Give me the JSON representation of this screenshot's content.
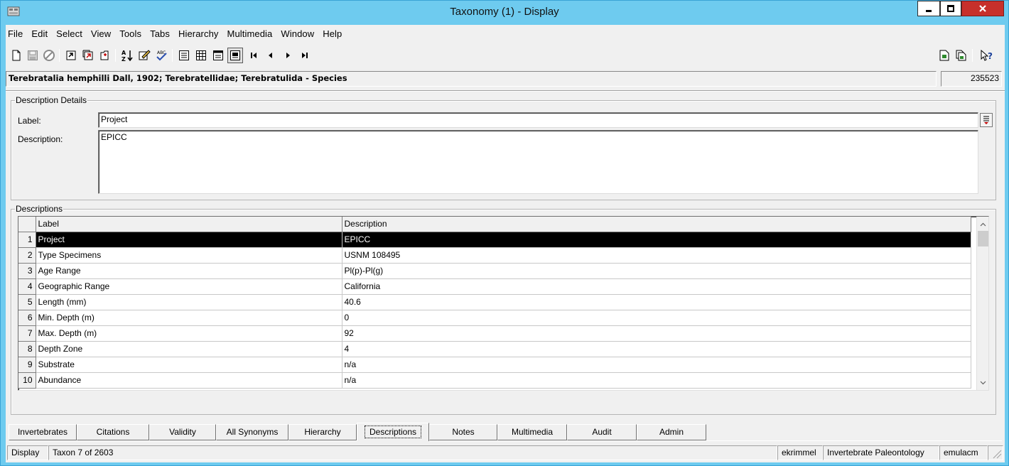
{
  "window": {
    "title": "Taxonomy (1) - Display"
  },
  "menu": [
    "File",
    "Edit",
    "Select",
    "View",
    "Tools",
    "Tabs",
    "Hierarchy",
    "Multimedia",
    "Window",
    "Help"
  ],
  "record": {
    "title": "Terebratalia hemphilli Dall, 1902; Terebratellidae; Terebratulida - Species",
    "id": "235523"
  },
  "details": {
    "legend": "Description Details",
    "label_caption": "Label:",
    "label_value": "Project",
    "description_caption": "Description:",
    "description_value": "EPICC"
  },
  "descriptions": {
    "legend": "Descriptions",
    "columns": [
      "Label",
      "Description"
    ],
    "rows": [
      {
        "num": "1",
        "label": "Project",
        "description": "EPICC"
      },
      {
        "num": "2",
        "label": "Type Specimens",
        "description": "USNM 108495"
      },
      {
        "num": "3",
        "label": "Age Range",
        "description": "Pl(p)-Pl(g)"
      },
      {
        "num": "4",
        "label": "Geographic Range",
        "description": "California"
      },
      {
        "num": "5",
        "label": "Length (mm)",
        "description": "40.6"
      },
      {
        "num": "6",
        "label": "Min. Depth (m)",
        "description": "0"
      },
      {
        "num": "7",
        "label": "Max. Depth (m)",
        "description": "92"
      },
      {
        "num": "8",
        "label": "Depth Zone",
        "description": "4"
      },
      {
        "num": "9",
        "label": "Substrate",
        "description": "n/a"
      },
      {
        "num": "10",
        "label": "Abundance",
        "description": "n/a"
      }
    ],
    "selected_row": 0
  },
  "tabs": [
    {
      "label": "Invertebrates",
      "active": false
    },
    {
      "label": "Citations",
      "active": false
    },
    {
      "label": "Validity",
      "active": false
    },
    {
      "label": "All Synonyms",
      "active": false
    },
    {
      "label": "Hierarchy",
      "active": false
    },
    {
      "label": "Descriptions",
      "active": true
    },
    {
      "label": "Notes",
      "active": false
    },
    {
      "label": "Multimedia",
      "active": false
    },
    {
      "label": "Audit",
      "active": false
    },
    {
      "label": "Admin",
      "active": false
    }
  ],
  "status": {
    "mode": "Display",
    "position": "Taxon 7 of 2603",
    "user": "ekrimmel",
    "department": "Invertebrate Paleontology",
    "server": "emulacm"
  },
  "toolbar_icons": [
    "new-record-icon",
    "save-icon",
    "cancel-icon",
    "open-icon",
    "open-attached-icon",
    "close-record-icon",
    "sort-icon",
    "edit-note-icon",
    "spellcheck-icon",
    "details-view-icon",
    "list-view-icon",
    "page-view-icon",
    "display-view-icon",
    "first-record-icon",
    "previous-record-icon",
    "next-record-icon",
    "last-record-icon",
    "report-icon",
    "report-copy-icon",
    "help-pointer-icon"
  ],
  "colors": {
    "accent": "#6ecbef",
    "close": "#c7302b",
    "selected_row": "#000000"
  }
}
